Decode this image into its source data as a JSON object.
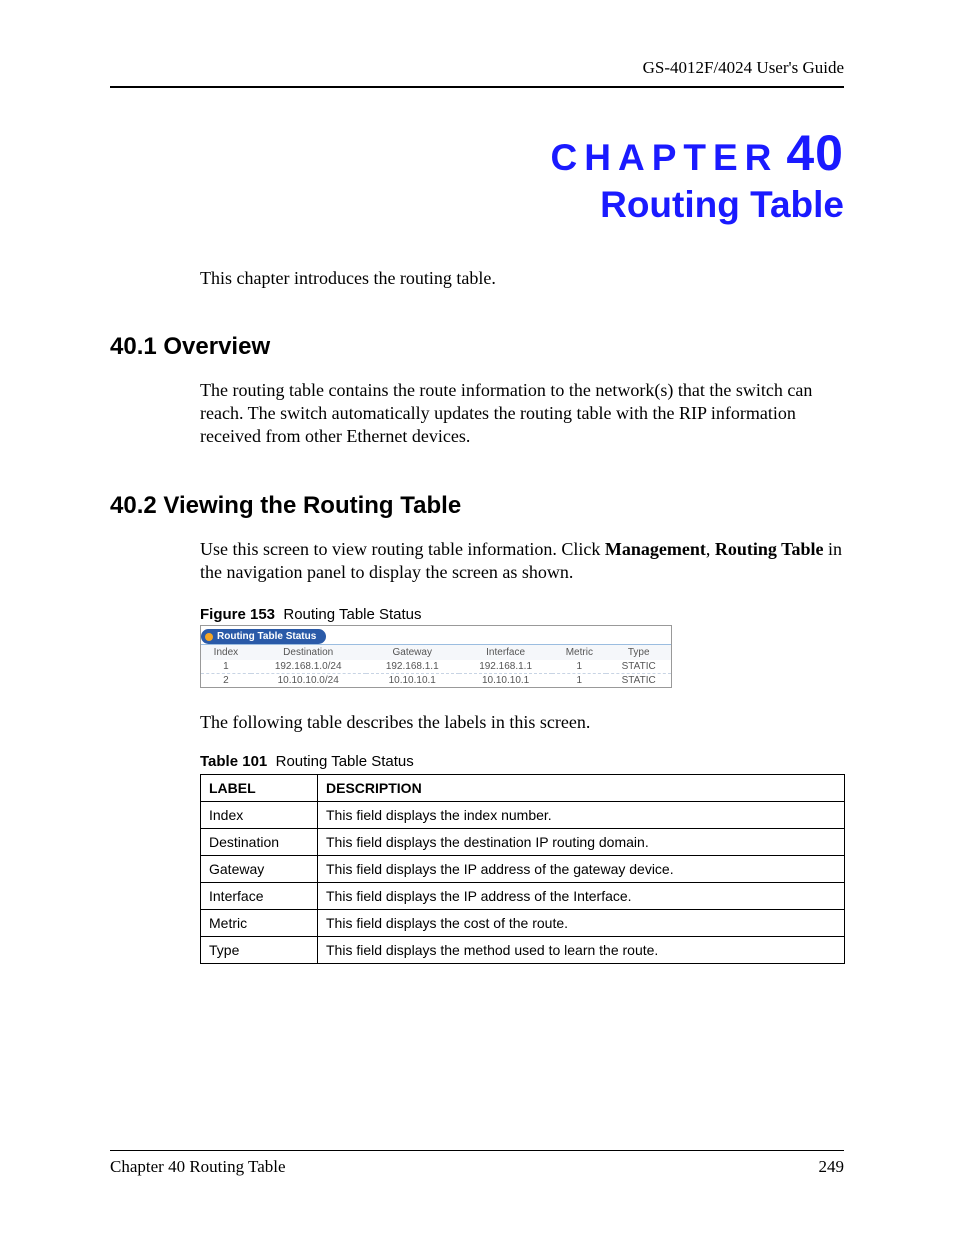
{
  "header": {
    "guide": "GS-4012F/4024 User's Guide"
  },
  "chapter": {
    "label_letters": "CHAPTER",
    "number": "40",
    "title": "Routing Table",
    "intro": "This chapter introduces the routing table."
  },
  "sections": {
    "s1": {
      "heading": "40.1  Overview",
      "body": "The routing table contains the route information to the network(s) that the switch can reach. The switch automatically updates the routing table with the RIP information received from other Ethernet devices."
    },
    "s2": {
      "heading": "40.2  Viewing the Routing Table",
      "body_pre": "Use this screen to view routing table information. Click ",
      "body_bold1": "Management",
      "body_mid": ", ",
      "body_bold2": "Routing Table",
      "body_post": " in the navigation panel to display the screen as shown."
    }
  },
  "figure": {
    "caption_label": "Figure 153",
    "caption_text": "Routing Table Status",
    "panel_title": "Routing Table Status",
    "headers": [
      "Index",
      "Destination",
      "Gateway",
      "Interface",
      "Metric",
      "Type"
    ],
    "rows": [
      [
        "1",
        "192.168.1.0/24",
        "192.168.1.1",
        "192.168.1.1",
        "1",
        "STATIC"
      ],
      [
        "2",
        "10.10.10.0/24",
        "10.10.10.1",
        "10.10.10.1",
        "1",
        "STATIC"
      ]
    ]
  },
  "after_figure": "The following table describes the labels in this screen.",
  "table101": {
    "caption_label": "Table 101",
    "caption_text": "Routing Table Status",
    "headers": [
      "LABEL",
      "DESCRIPTION"
    ],
    "rows": [
      [
        "Index",
        "This field displays the index number."
      ],
      [
        "Destination",
        "This field displays the destination IP routing domain."
      ],
      [
        "Gateway",
        "This field displays the IP address of the gateway device."
      ],
      [
        "Interface",
        "This field displays the IP address of the Interface."
      ],
      [
        "Metric",
        "This field displays the cost of the route."
      ],
      [
        "Type",
        "This field displays the method used to learn the route."
      ]
    ]
  },
  "footer": {
    "left": "Chapter 40 Routing Table",
    "right": "249"
  }
}
